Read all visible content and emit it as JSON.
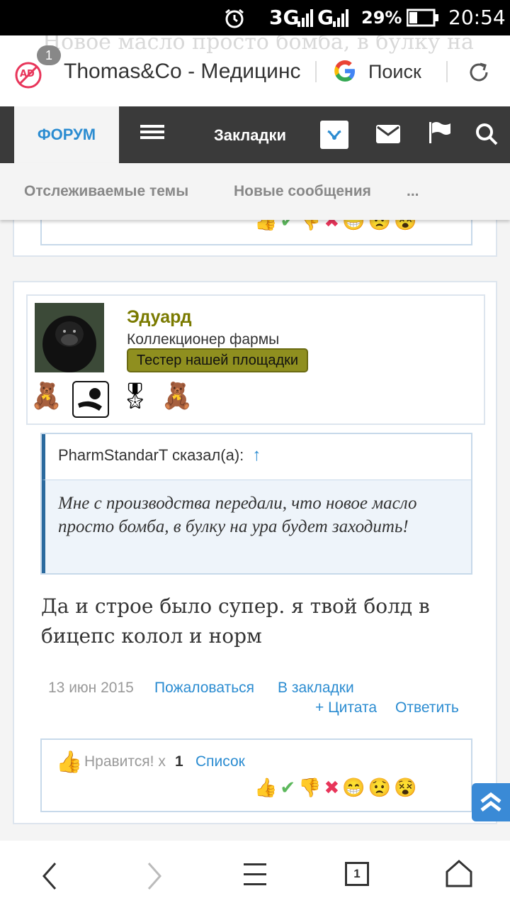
{
  "status_bar": {
    "network": "3G",
    "network2": "G",
    "battery": "29%",
    "time": "20:54"
  },
  "browser": {
    "ad_badge": "1",
    "ad_label": "AD",
    "background_text": "Новое масло просто бомба, в булку на",
    "page_title": "Thomas&Co - Медицинс",
    "search_label": "Поиск"
  },
  "nav": {
    "forum": "ФОРУМ",
    "bookmarks": "Закладки"
  },
  "subnav": {
    "item1": "Отслеживаемые темы",
    "item2": "Новые сообщения",
    "more": "..."
  },
  "post": {
    "username": "Эдуард",
    "user_title": "Коллекционер фармы",
    "user_badge": "Тестер нашей площадки",
    "quote_author": "PharmStandarT сказал(а):",
    "quote_arrow": "↑",
    "quote_text": "Мне с производства передали, что новое масло просто бомба, в булку на ура будет заходить!",
    "message": "Да и строе было супер. я твой болд в бицепс колол и норм",
    "date": "13 июн 2015",
    "report": "Пожаловаться",
    "bookmark": "В закладки",
    "quote_action": "+ Цитата",
    "reply": "Ответить",
    "likes_label": "Нравится! x",
    "likes_count": "1",
    "likes_list": "Список"
  },
  "colors": {
    "accent": "#2b8cd1",
    "username": "#7a7a00",
    "badge_bg": "#8f8f1f",
    "navbar": "#3a3a3a"
  },
  "bottom_nav": {
    "tabs_count": "1"
  }
}
